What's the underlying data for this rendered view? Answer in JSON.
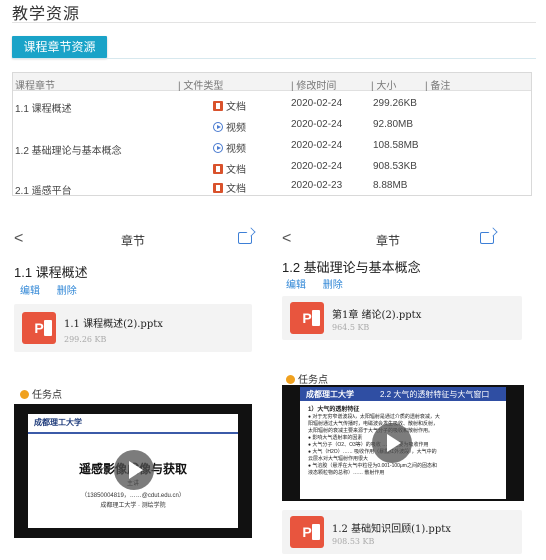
{
  "page": {
    "title": "教学资源"
  },
  "tab": {
    "label": "课程章节资源"
  },
  "table": {
    "columns": [
      "课程章节",
      "| 文件类型",
      "| 修改时间",
      "| 大小",
      "| 备注"
    ],
    "rows": [
      {
        "chapter": "1.1 课程概述",
        "type": "文档",
        "type_icon": "document-icon",
        "date": "2020-02-24",
        "size": "299.26KB"
      },
      {
        "chapter": "",
        "type": "视频",
        "type_icon": "video-icon",
        "date": "2020-02-24",
        "size": "92.80MB"
      },
      {
        "chapter": "1.2 基础理论与基本概念",
        "type": "视频",
        "type_icon": "video-icon",
        "date": "2020-02-24",
        "size": "108.58MB"
      },
      {
        "chapter": "",
        "type": "文档",
        "type_icon": "document-icon",
        "date": "2020-02-24",
        "size": "908.53KB"
      },
      {
        "chapter": "2.1 遥感平台",
        "type": "文档",
        "type_icon": "document-icon",
        "date": "2020-02-23",
        "size": "8.88MB"
      }
    ]
  },
  "mobile_left": {
    "header_title": "章节",
    "back_glyph": "<",
    "chapter": "1.1 课程概述",
    "edit_label": "编辑",
    "delete_label": "删除",
    "file": {
      "icon_text": "P",
      "name": "1.1 课程概述(2).pptx",
      "size": "299.26 KB"
    },
    "task_label": "任务点",
    "video": {
      "school": "成都理工大学",
      "main_text": "遥感影像成像与获取",
      "presenter": "主讲",
      "contact": "（13850004819，……@cdut.edu.cn）",
      "org": "成都理工大学 · 测绘学院"
    }
  },
  "mobile_right": {
    "header_title": "章节",
    "back_glyph": "<",
    "chapter": "1.2 基础理论与基本概念",
    "edit_label": "编辑",
    "delete_label": "删除",
    "file_top": {
      "icon_text": "P",
      "name": "第1章 绪论(2).pptx",
      "size": "964.5 KB"
    },
    "task_label": "任务点",
    "video": {
      "school": "成都理工大学",
      "heading": "2.2 大气的透射特征与大气窗口",
      "bullet_title": "1）大气的透射特征",
      "lines": [
        "● 对于无穷窄谱波段λ，太阳辐射是通过介质的透射衰减，大",
        "  阳辐射通过大气传播时，电磁波会发生吸收、散射和反射，",
        "  太阳辐射的衰减主要来源于大气分子的吸收和散射作用。",
        "● 影响大气透射率的因素",
        "● 大气分子（O2、O3等）的吸收 …… 主要为吸收作用",
        "● 大气（H2O）…… 吸收作用（暴露红外波段），大气中的",
        "  云层水对大气辐射作用很大",
        "● 气溶胶（悬浮在大气中粒径为0.001-100μm之间的固态和",
        "  液态颗粒物的总称）…… 散射作用"
      ]
    },
    "file_bottom": {
      "icon_text": "P",
      "name": "1.2 基础知识回顾(1).pptx",
      "size": "908.53 KB"
    }
  },
  "colors": {
    "accent": "#1aa3c8",
    "link": "#2f86d6",
    "ppt": "#e8553e",
    "task": "#f0a11f"
  }
}
